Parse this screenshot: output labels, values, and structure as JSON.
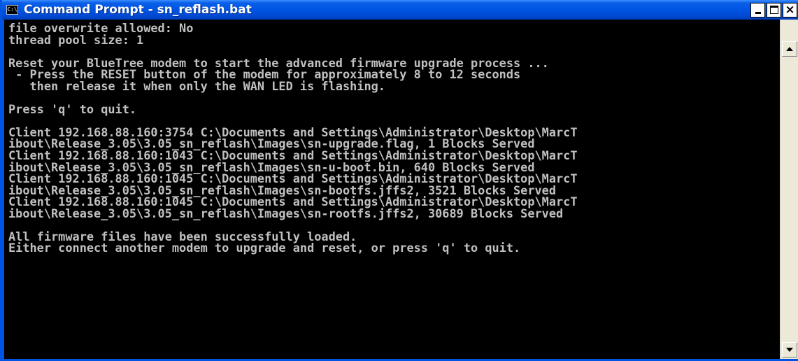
{
  "window": {
    "title": "Command Prompt - sn_reflash.bat",
    "icon": "C:\\",
    "close_glyph": "×"
  },
  "console": {
    "lines": [
      "file overwrite allowed: No",
      "thread pool size: 1",
      "",
      "Reset your BlueTree modem to start the advanced firmware upgrade process ...",
      " - Press the RESET button of the modem for approximately 8 to 12 seconds",
      "   then release it when only the WAN LED is flashing.",
      "",
      "Press 'q' to quit.",
      "",
      "Client 192.168.88.160:3754 C:\\Documents and Settings\\Administrator\\Desktop\\MarcT",
      "ibout\\Release_3.05\\3.05_sn_reflash\\Images\\sn-upgrade.flag, 1 Blocks Served",
      "Client 192.168.88.160:1043 C:\\Documents and Settings\\Administrator\\Desktop\\MarcT",
      "ibout\\Release_3.05\\3.05_sn_reflash\\Images\\sn-u-boot.bin, 640 Blocks Served",
      "Client 192.168.88.160:1045 C:\\Documents and Settings\\Administrator\\Desktop\\MarcT",
      "ibout\\Release_3.05\\3.05_sn_reflash\\Images\\sn-bootfs.jffs2, 3521 Blocks Served",
      "Client 192.168.88.160:1045 C:\\Documents and Settings\\Administrator\\Desktop\\MarcT",
      "ibout\\Release_3.05\\3.05_sn_reflash\\Images\\sn-rootfs.jffs2, 30689 Blocks Served",
      "",
      "All firmware files have been successfully loaded.",
      "Either connect another modem to upgrade and reset, or press 'q' to quit."
    ]
  }
}
